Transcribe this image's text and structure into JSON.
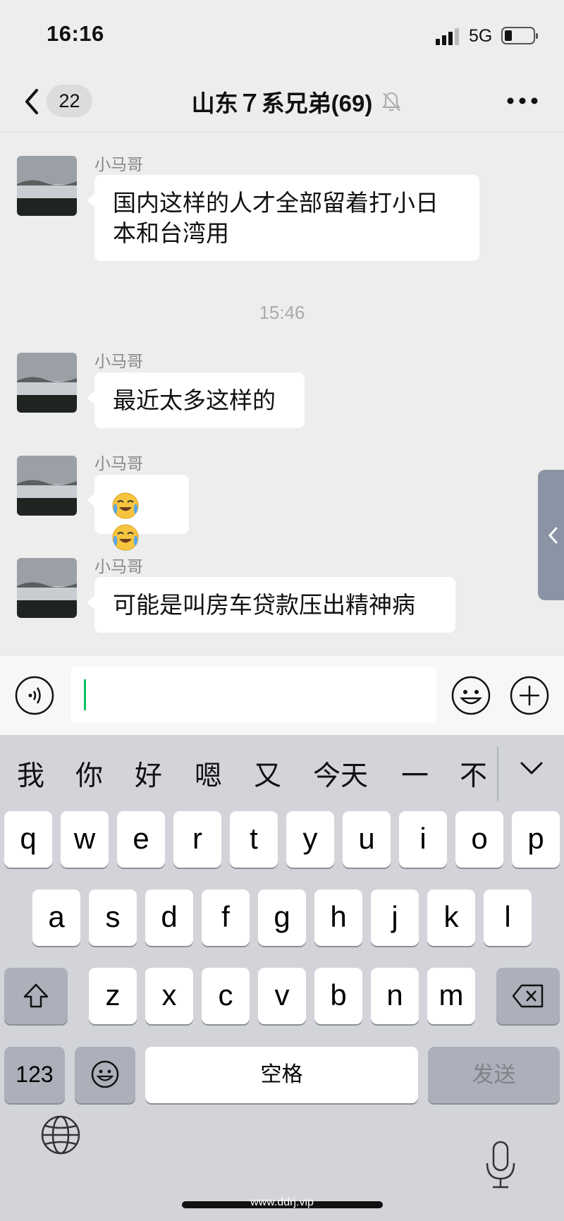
{
  "status_bar": {
    "time": "16:16",
    "network": "5G"
  },
  "nav": {
    "back_badge": "22",
    "title": "山东７系兄弟(69)"
  },
  "messages": [
    {
      "sender": "小马哥",
      "text_line1": "国内这样的人才全部留着打小日",
      "text_line2": "本和台湾用"
    },
    {
      "sender": "小马哥",
      "text": "最近太多这样的"
    },
    {
      "sender": "小马哥",
      "emojis": [
        "crying-laughing",
        "crying-laughing"
      ]
    },
    {
      "sender": "小马哥",
      "text": "可能是叫房车贷款压出精神病"
    }
  ],
  "timestamp": "15:46",
  "input": {
    "value": ""
  },
  "keyboard": {
    "candidates": [
      "我",
      "你",
      "好",
      "嗯",
      "又",
      "今天",
      "一",
      "不"
    ],
    "row1": [
      "q",
      "w",
      "e",
      "r",
      "t",
      "y",
      "u",
      "i",
      "o",
      "p"
    ],
    "row2": [
      "a",
      "s",
      "d",
      "f",
      "g",
      "h",
      "j",
      "k",
      "l"
    ],
    "row3": [
      "z",
      "x",
      "c",
      "v",
      "b",
      "n",
      "m"
    ],
    "numbers_key": "123",
    "space_key": "空格",
    "send_key": "发送"
  },
  "watermark": "www.ddrj.vip",
  "colors": {
    "accent_green": "#07c160",
    "bubble_bg": "#ffffff",
    "page_bg": "#ededed",
    "keyboard_bg": "#d2d4d9"
  }
}
